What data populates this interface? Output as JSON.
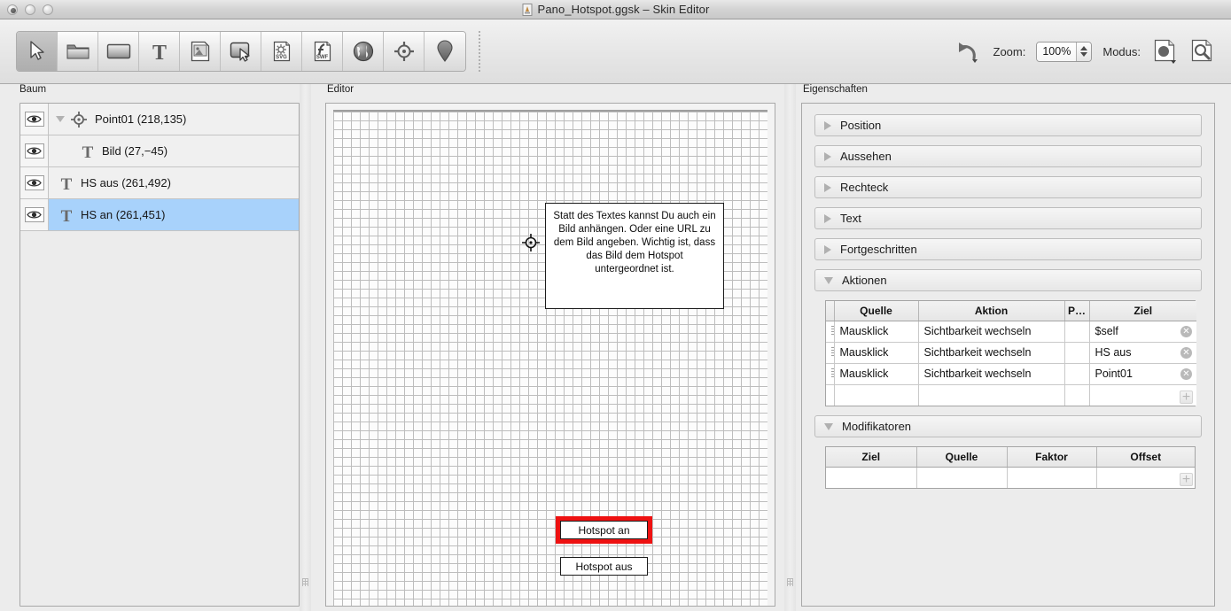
{
  "window": {
    "title": "Pano_Hotspot.ggsk – Skin Editor",
    "traffic_lights": [
      "close-button",
      "minimize-button",
      "zoom-button"
    ]
  },
  "toolbar": {
    "tools": [
      {
        "name": "select-tool",
        "icon": "arrow-cursor-icon",
        "active": true
      },
      {
        "name": "folder-tool",
        "icon": "folder-icon",
        "active": false
      },
      {
        "name": "rectangle-tool",
        "icon": "rectangle-icon",
        "active": false
      },
      {
        "name": "text-tool",
        "icon": "text-t-icon",
        "active": false
      },
      {
        "name": "image-tool",
        "icon": "image-icon",
        "active": false
      },
      {
        "name": "button-tool",
        "icon": "button-cursor-icon",
        "active": false
      },
      {
        "name": "svg-tool",
        "icon": "svg-file-icon",
        "active": false
      },
      {
        "name": "swf-tool",
        "icon": "swf-file-icon",
        "active": false
      },
      {
        "name": "globe-tool",
        "icon": "globe-icon",
        "active": false
      },
      {
        "name": "hotspot-tool",
        "icon": "crosshair-icon",
        "active": false
      },
      {
        "name": "pin-tool",
        "icon": "map-pin-icon",
        "active": false
      }
    ],
    "undo_label": "undo-icon",
    "zoom_label": "Zoom:",
    "zoom_value": "100%",
    "modus_label": "Modus:",
    "modus_buttons": [
      {
        "name": "modus-preview-button",
        "icon": "dot-page-icon"
      },
      {
        "name": "modus-inspect-button",
        "icon": "magnifier-page-icon"
      }
    ]
  },
  "tree": {
    "label": "Baum",
    "items": [
      {
        "label": "Point01 (218,135)",
        "icon": "crosshair-icon",
        "indent": 0,
        "disclosure": true,
        "selected": false,
        "eye": "eye-icon"
      },
      {
        "label": "Bild (27,−45)",
        "icon": "text-t-icon",
        "indent": 1,
        "disclosure": false,
        "selected": false,
        "eye": "eye-icon"
      },
      {
        "label": "HS aus (261,492)",
        "icon": "text-t-icon",
        "indent": 0,
        "disclosure": false,
        "selected": false,
        "eye": "eye-icon"
      },
      {
        "label": "HS an (261,451)",
        "icon": "text-t-icon",
        "indent": 0,
        "disclosure": false,
        "selected": true,
        "eye": "eye-icon"
      }
    ],
    "selection_color": "#a8d2fb"
  },
  "editor": {
    "label": "Editor",
    "textbox": "Statt des Textes kannst Du auch ein Bild anhängen. Oder eine URL zu dem Bild angeben. Wichtig ist, dass das Bild dem Hotspot untergeordnet ist.",
    "hotspot_on_label": "Hotspot an",
    "hotspot_off_label": "Hotspot aus",
    "selection_color": "#ee1111",
    "marker": "crosshair-icon"
  },
  "properties": {
    "label": "Eigenschaften",
    "sections": [
      {
        "label": "Position",
        "expanded": false
      },
      {
        "label": "Aussehen",
        "expanded": false
      },
      {
        "label": "Rechteck",
        "expanded": false
      },
      {
        "label": "Text",
        "expanded": false
      },
      {
        "label": "Fortgeschritten",
        "expanded": false
      },
      {
        "label": "Aktionen",
        "expanded": true
      },
      {
        "label": "Modifikatoren",
        "expanded": true
      }
    ],
    "aktionen": {
      "columns": [
        "Quelle",
        "Aktion",
        "P…",
        "Ziel"
      ],
      "rows": [
        {
          "quelle": "Mausklick",
          "aktion": "Sichtbarkeit wechseln",
          "p": "",
          "ziel": "$self"
        },
        {
          "quelle": "Mausklick",
          "aktion": "Sichtbarkeit wechseln",
          "p": "",
          "ziel": "HS aus"
        },
        {
          "quelle": "Mausklick",
          "aktion": "Sichtbarkeit wechseln",
          "p": "",
          "ziel": "Point01"
        },
        {
          "quelle": "",
          "aktion": "",
          "p": "",
          "ziel": ""
        }
      ],
      "delete_glyph": "✕",
      "add_glyph": "+"
    },
    "modifikatoren": {
      "columns": [
        "Ziel",
        "Quelle",
        "Faktor",
        "Offset"
      ],
      "rows": [
        {
          "ziel": "",
          "quelle": "",
          "faktor": "",
          "offset": ""
        }
      ],
      "add_glyph": "+"
    }
  }
}
